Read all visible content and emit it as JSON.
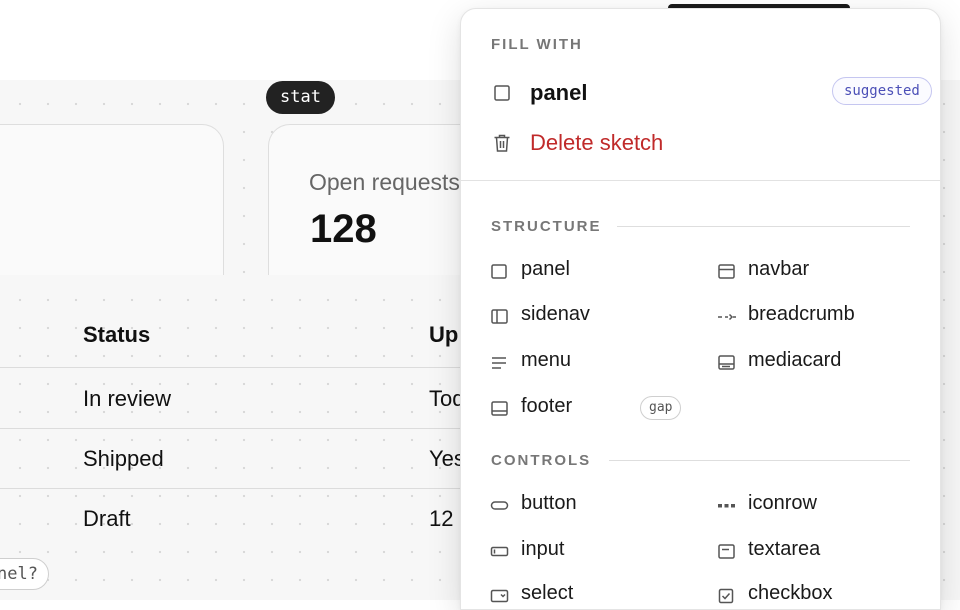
{
  "background": {
    "stat_tag": "stat",
    "card": {
      "label": "Open requests",
      "value": "128"
    },
    "table": {
      "headers": [
        "Status",
        "Up"
      ],
      "rows": [
        [
          "In review",
          "Tod"
        ],
        [
          "Shipped",
          "Yes"
        ],
        [
          "Draft",
          "12"
        ]
      ]
    },
    "corner_chip": "nel?"
  },
  "dropdown": {
    "fill_with": {
      "title": "FILL WITH",
      "primary": {
        "label": "panel",
        "icon": "square-icon",
        "badge": "suggested"
      },
      "delete": {
        "label": "Delete sketch",
        "icon": "trash-icon"
      }
    },
    "structure": {
      "title": "STRUCTURE",
      "items": [
        {
          "label": "panel",
          "icon": "panel-icon"
        },
        {
          "label": "navbar",
          "icon": "navbar-icon"
        },
        {
          "label": "sidenav",
          "icon": "sidenav-icon"
        },
        {
          "label": "breadcrumb",
          "icon": "breadcrumb-icon"
        },
        {
          "label": "menu",
          "icon": "menu-icon"
        },
        {
          "label": "mediacard",
          "icon": "mediacard-icon"
        },
        {
          "label": "footer",
          "icon": "footer-icon",
          "badge": "gap"
        }
      ]
    },
    "controls": {
      "title": "CONTROLS",
      "items": [
        {
          "label": "button",
          "icon": "button-icon"
        },
        {
          "label": "iconrow",
          "icon": "iconrow-icon"
        },
        {
          "label": "input",
          "icon": "input-icon"
        },
        {
          "label": "textarea",
          "icon": "textarea-icon"
        },
        {
          "label": "select",
          "icon": "select-icon"
        },
        {
          "label": "checkbox",
          "icon": "checkbox-icon"
        }
      ]
    }
  },
  "colors": {
    "danger": "#c02a2a",
    "suggested_accent": "#4b4fb7"
  }
}
